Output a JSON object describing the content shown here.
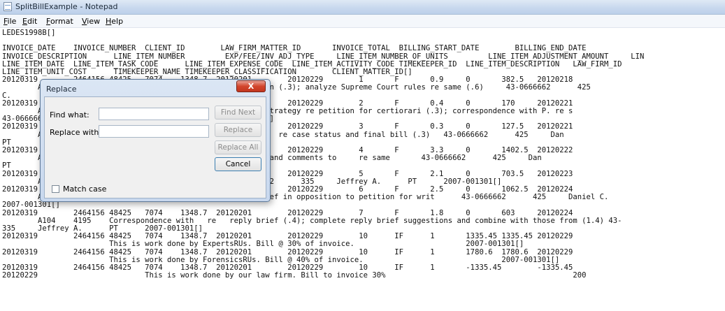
{
  "window": {
    "title": "SplitBillExample - Notepad"
  },
  "menu": {
    "file": "File",
    "edit": "Edit",
    "format": "Format",
    "view": "View",
    "help": "Help"
  },
  "document": {
    "lines": [
      "LEDES1998B[]",
      "",
      "INVOICE_DATE    INVOICE_NUMBER  CLIENT_ID        LAW_FIRM_MATTER_ID       INVOICE_TOTAL  BILLING_START_DATE        BILLING_END_DATE",
      "INVOICE_DESCRIPTION      LINE_ITEM_NUMBER         EXP/FEE/INV_ADJ_TYPE     LINE_ITEM_NUMBER_OF_UNITS         LINE_ITEM_ADJUSTMENT_AMOUNT     LIN",
      "LINE_ITEM_DATE  LINE_ITEM_TASK_CODE      LINE_ITEM_EXPENSE_CODE  LINE_ITEM_ACTIVITY_CODE TIMEKEEPER_ID  LINE_ITEM_DESCRIPTION   LAW_FIRM_ID",
      "LINE_ITEM_UNIT_COST      TIMEKEEPER_NAME TIMEKEEPER_CLASSIFICATION        CLIENT_MATTER_ID[]",
      "20120319        2464156 48425   7074    1348.7  20120201        20120229        1       F       0.9     0       382.5   20120218",
      "        A104    4195    Correspondence with  re cert petition (.3); analyze Supreme Court rules re same (.6)     43-0666662      425",
      "C.",
      "20120319        2464156 48425   7074    1348.7  20120201        20120229        2       F       0.4     0       170     20120221",
      "        A106    4195    Correspondence with  re status and strategy re petition for certiorari (.3); correspondence with P. re s",
      "43-0666662      425     Daniel C.       PT      2007-001301[]",
      "20120319        2464156 48425   7074    1348.7  20120201        20120229        3       F       0.3     0       127.5   20120221",
      "        A107    4195    Correspondence and telephone call to  re case status and final bill (.3)   43-0666662      425     Dan",
      "PT",
      "20120319        2464156 48425   7074    1348.7  20120201        20120229        4       F       3.3     0       1402.5  20120222",
      "        A103    4195    Draft response to petition for cert and comments to     re same       43-0666662      425     Dan",
      "PT",
      "20120319        2464156 48425   7074    1348.7  20120201        20120229        5       F       2.1     0       703.5   20120223",
      "        A103    4195    Draft of reply brief       43-0666662      335     Jeffrey A.      PT      2007-001301[]",
      "20120319        2464156 48425   7074    1348.7  20120201        20120229        6       F       2.5     0       1062.5  20120224",
      "        A107    790     Draft and revise comments for re brief in opposition to petition for writ      43-0666662      425     Daniel C.",
      "2007-001301[]",
      "20120319        2464156 48425   7074    1348.7  20120201        20120229        7       F       1.8     0       603     20120224",
      "        A104    4195    Correspondence with   re   reply brief (.4); complete reply brief suggestions and combine with those from (1.4) 43-",
      "335     Jeffrey A.      PT      2007-001301[]",
      "20120319        2464156 48425   7074    1348.7  20120201        20120229        10      IF      1       1335.45 1335.45 20120229",
      "                        This is work done by ExpertsRUs. Bill @ 30% of invoice.                         2007-001301[]",
      "20120319        2464156 48425   7074    1348.7  20120201        20120229        10      IF      1       1780.6  1780.6  20120229",
      "                        This is work done by ForensicsRUs. Bill @ 40% of invoice.                               2007-001301[]",
      "20120319        2464156 48425   7074    1348.7  20120201        20120229        10      IF      1       -1335.45        -1335.45",
      "20120229                        This is work done by our law firm. Bill to invoice 30%                                          200"
    ]
  },
  "dialog": {
    "title": "Replace",
    "close": "X",
    "find_label": "Find what:",
    "replace_label": "Replace with:",
    "find_value": "",
    "replace_value": "",
    "find_next": "Find Next",
    "replace": "Replace",
    "replace_all": "Replace All",
    "cancel": "Cancel",
    "match_case": "Match case"
  }
}
